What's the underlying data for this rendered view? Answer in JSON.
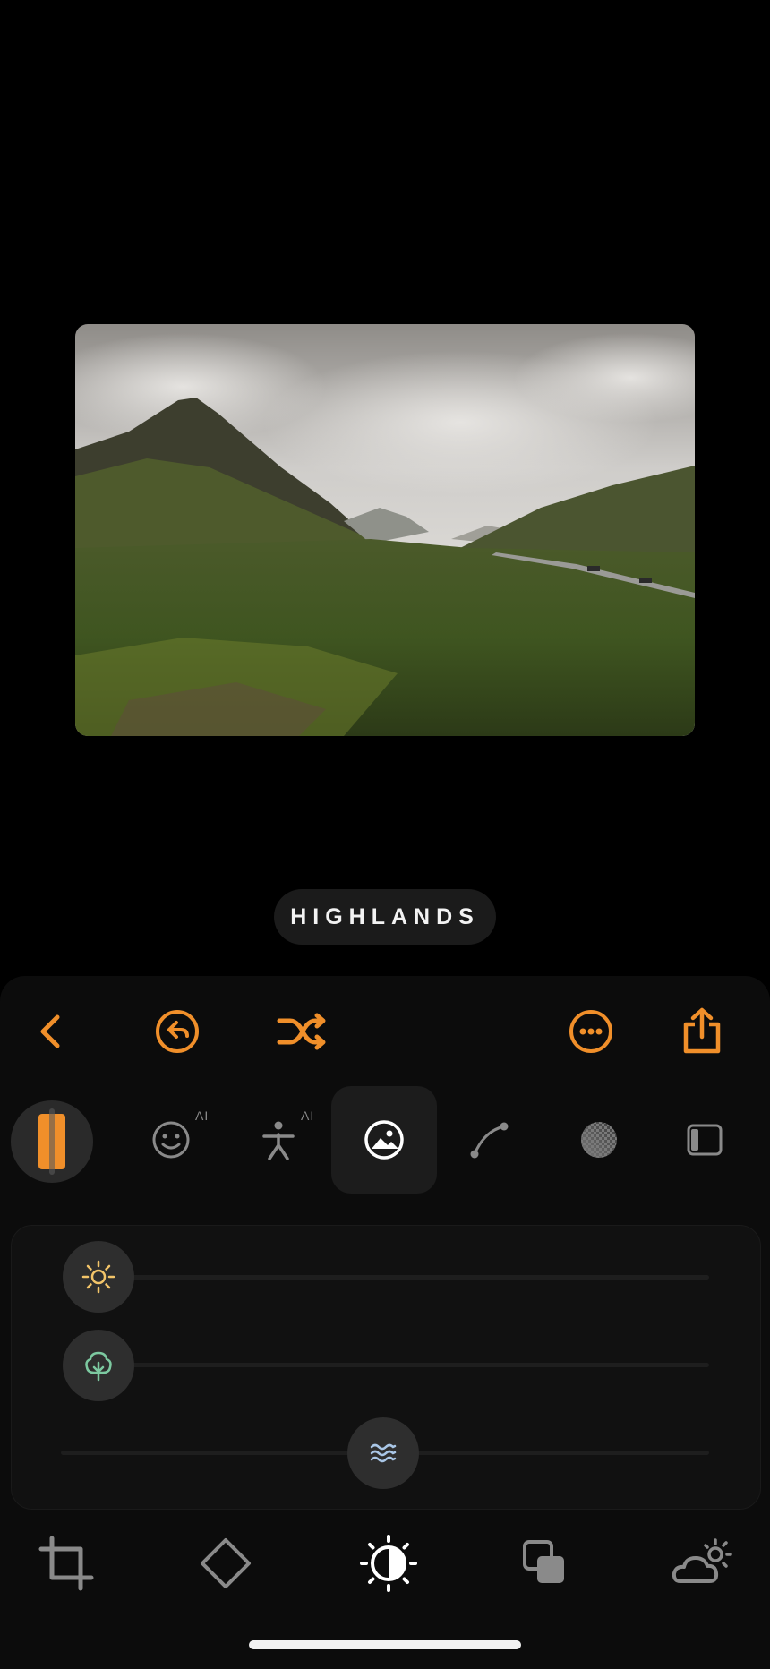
{
  "preset": {
    "name": "HIGHLANDS"
  },
  "colors": {
    "accent": "#f08f2a",
    "sun": "#f2c469",
    "tree": "#7cc9a0",
    "wave": "#a9c6e6"
  },
  "toolbar": {
    "back_icon": "chevron-left-icon",
    "undo_icon": "undo-icon",
    "shuffle_icon": "shuffle-icon",
    "more_icon": "more-icon",
    "share_icon": "share-icon"
  },
  "categories": [
    {
      "icon": "color-swatch-icon"
    },
    {
      "icon": "face-icon",
      "tag": "AI"
    },
    {
      "icon": "person-icon",
      "tag": "AI"
    },
    {
      "icon": "landscape-icon",
      "active": true
    },
    {
      "icon": "curve-icon"
    },
    {
      "icon": "grain-icon"
    },
    {
      "icon": "vignette-icon"
    }
  ],
  "sliders": [
    {
      "icon": "sun-icon",
      "value": 0.0
    },
    {
      "icon": "tree-icon",
      "value": 0.0
    },
    {
      "icon": "water-wave-icon",
      "value": 0.5
    }
  ],
  "bottom_tabs": [
    {
      "icon": "crop-icon"
    },
    {
      "icon": "diamond-icon"
    },
    {
      "icon": "adjust-icon",
      "active": true
    },
    {
      "icon": "overlay-icon"
    },
    {
      "icon": "weather-icon"
    }
  ]
}
